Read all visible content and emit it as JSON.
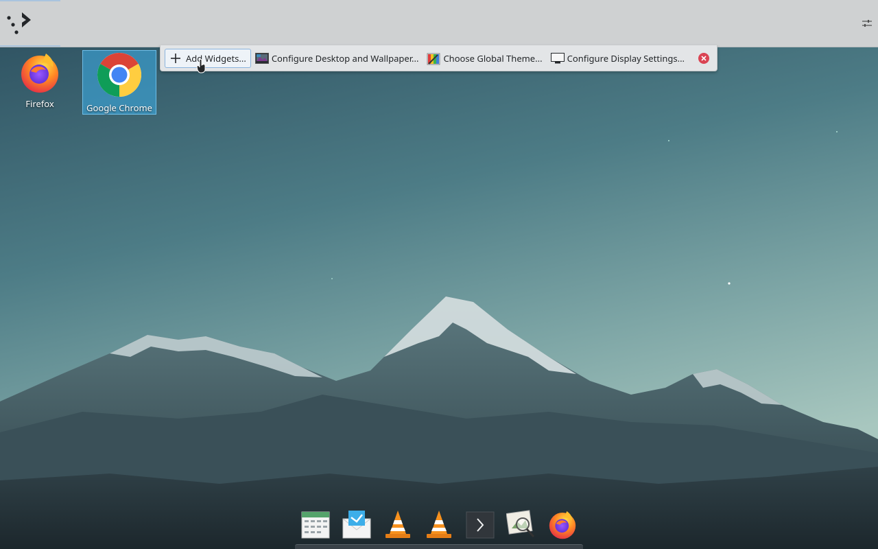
{
  "toolbox": {
    "add_widgets": "Add Widgets...",
    "configure_desktop": "Configure Desktop and Wallpaper...",
    "choose_theme": "Choose Global Theme...",
    "configure_display": "Configure Display Settings..."
  },
  "desktop": {
    "icons": [
      {
        "label": "Firefox",
        "icon": "firefox-icon"
      },
      {
        "label": "Google Chrome",
        "icon": "chrome-icon",
        "selected": true
      }
    ]
  },
  "dock": {
    "items": [
      "calendar-icon",
      "mail-icon",
      "vlc-icon",
      "vlc-icon",
      "terminal-icon",
      "image-viewer-icon",
      "firefox-icon"
    ]
  },
  "colors": {
    "panel_bg": "#cfd1d2",
    "toolbox_bg": "#e3e5e7",
    "selection": "#3daee9",
    "close": "#da4453",
    "sky_top": "#2c4f5e",
    "sky_bottom": "#8fb4b2"
  }
}
